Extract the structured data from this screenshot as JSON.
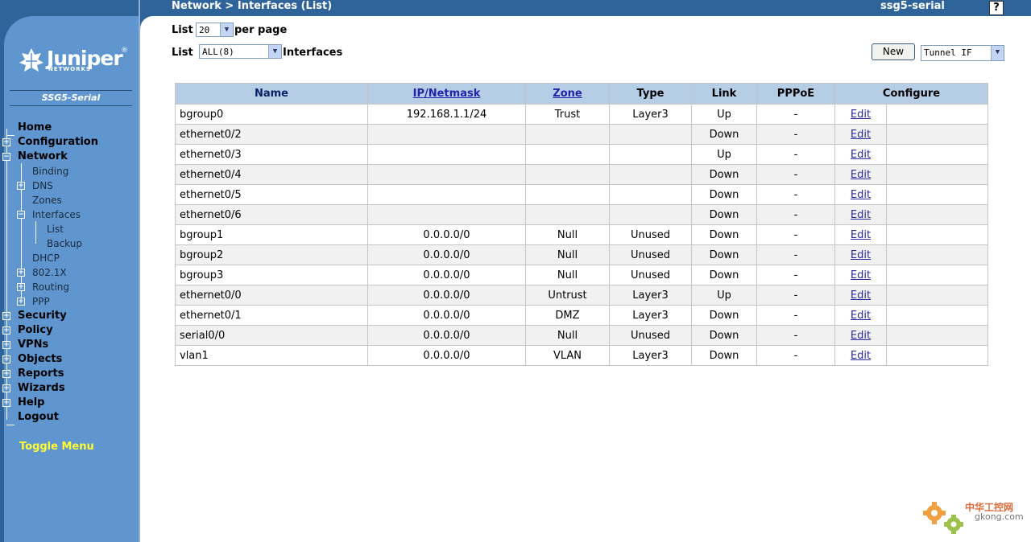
{
  "header": {
    "breadcrumb": "Network > Interfaces (List)",
    "device_name": "ssg5-serial",
    "help_label": "?"
  },
  "sidebar": {
    "logo_text": "Juniper",
    "logo_sub": "NETWORKS",
    "logo_reg": "®",
    "model": "SSG5-Serial",
    "toggle_menu": "Toggle Menu",
    "items": [
      {
        "label": "Home"
      },
      {
        "label": "Configuration",
        "expander": "+"
      },
      {
        "label": "Network",
        "expander": "−"
      },
      {
        "label": "Binding"
      },
      {
        "label": "DNS",
        "expander": "+"
      },
      {
        "label": "Zones"
      },
      {
        "label": "Interfaces",
        "expander": "−"
      },
      {
        "label": "List"
      },
      {
        "label": "Backup"
      },
      {
        "label": "DHCP"
      },
      {
        "label": "802.1X",
        "expander": "+"
      },
      {
        "label": "Routing",
        "expander": "+"
      },
      {
        "label": "PPP",
        "expander": "+"
      },
      {
        "label": "Security",
        "expander": "+"
      },
      {
        "label": "Policy",
        "expander": "+"
      },
      {
        "label": "VPNs",
        "expander": "+"
      },
      {
        "label": "Objects",
        "expander": "+"
      },
      {
        "label": "Reports",
        "expander": "+"
      },
      {
        "label": "Wizards",
        "expander": "+"
      },
      {
        "label": "Help",
        "expander": "+"
      },
      {
        "label": "Logout"
      }
    ]
  },
  "controls": {
    "list_label": "List",
    "per_page_value": "20",
    "per_page_label": "per page",
    "list_label2": "List",
    "filter_value": "ALL(8)",
    "interfaces_label": "Interfaces",
    "new_button": "New",
    "type_value": "Tunnel IF"
  },
  "table": {
    "columns": [
      "Name",
      "IP/Netmask",
      "Zone",
      "Type",
      "Link",
      "PPPoE",
      "Configure"
    ],
    "edit_label": "Edit",
    "rows": [
      {
        "name": "bgroup0",
        "ip": "192.168.1.1/24",
        "zone": "Trust",
        "type": "Layer3",
        "link": "Up",
        "pppoe": "-"
      },
      {
        "name": "ethernet0/2",
        "ip": "",
        "zone": "",
        "type": "",
        "link": "Down",
        "pppoe": "-"
      },
      {
        "name": "ethernet0/3",
        "ip": "",
        "zone": "",
        "type": "",
        "link": "Up",
        "pppoe": "-"
      },
      {
        "name": "ethernet0/4",
        "ip": "",
        "zone": "",
        "type": "",
        "link": "Down",
        "pppoe": "-"
      },
      {
        "name": "ethernet0/5",
        "ip": "",
        "zone": "",
        "type": "",
        "link": "Down",
        "pppoe": "-"
      },
      {
        "name": "ethernet0/6",
        "ip": "",
        "zone": "",
        "type": "",
        "link": "Down",
        "pppoe": "-"
      },
      {
        "name": "bgroup1",
        "ip": "0.0.0.0/0",
        "zone": "Null",
        "type": "Unused",
        "link": "Down",
        "pppoe": "-"
      },
      {
        "name": "bgroup2",
        "ip": "0.0.0.0/0",
        "zone": "Null",
        "type": "Unused",
        "link": "Down",
        "pppoe": "-"
      },
      {
        "name": "bgroup3",
        "ip": "0.0.0.0/0",
        "zone": "Null",
        "type": "Unused",
        "link": "Down",
        "pppoe": "-"
      },
      {
        "name": "ethernet0/0",
        "ip": "0.0.0.0/0",
        "zone": "Untrust",
        "type": "Layer3",
        "link": "Up",
        "pppoe": "-"
      },
      {
        "name": "ethernet0/1",
        "ip": "0.0.0.0/0",
        "zone": "DMZ",
        "type": "Layer3",
        "link": "Down",
        "pppoe": "-"
      },
      {
        "name": "serial0/0",
        "ip": "0.0.0.0/0",
        "zone": "Null",
        "type": "Unused",
        "link": "Down",
        "pppoe": "-"
      },
      {
        "name": "vlan1",
        "ip": "0.0.0.0/0",
        "zone": "VLAN",
        "type": "Layer3",
        "link": "Down",
        "pppoe": "-"
      }
    ]
  },
  "watermark": {
    "cn_text": "中华工控网",
    "domain": "gkong.com"
  }
}
